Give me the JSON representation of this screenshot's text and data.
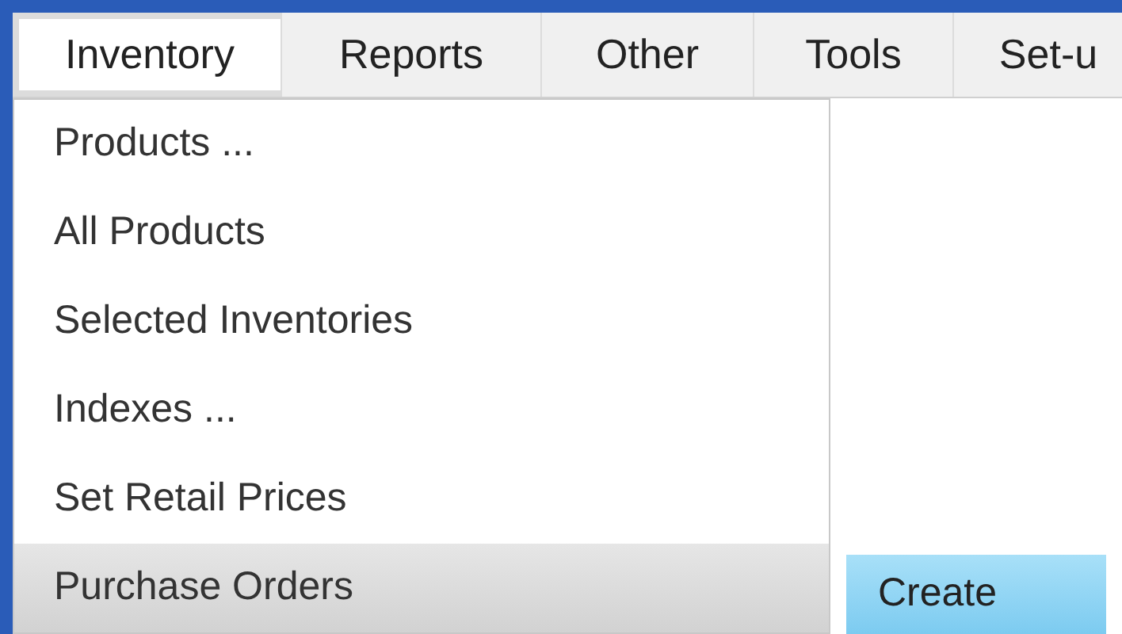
{
  "menu_bar": [
    {
      "label": "Inventory",
      "selected": true
    },
    {
      "label": "Reports",
      "selected": false
    },
    {
      "label": "Other",
      "selected": false
    },
    {
      "label": "Tools",
      "selected": false
    },
    {
      "label": "Set-u",
      "selected": false
    }
  ],
  "dropdown": [
    {
      "label": "Products ...",
      "selected": false
    },
    {
      "label": "All Products",
      "selected": false
    },
    {
      "label": "Selected Inventories",
      "selected": false
    },
    {
      "label": "Indexes ...",
      "selected": false
    },
    {
      "label": "Set Retail Prices",
      "selected": false
    },
    {
      "label": "Purchase Orders",
      "selected": true
    }
  ],
  "submenu": [
    {
      "label": "Create"
    }
  ]
}
